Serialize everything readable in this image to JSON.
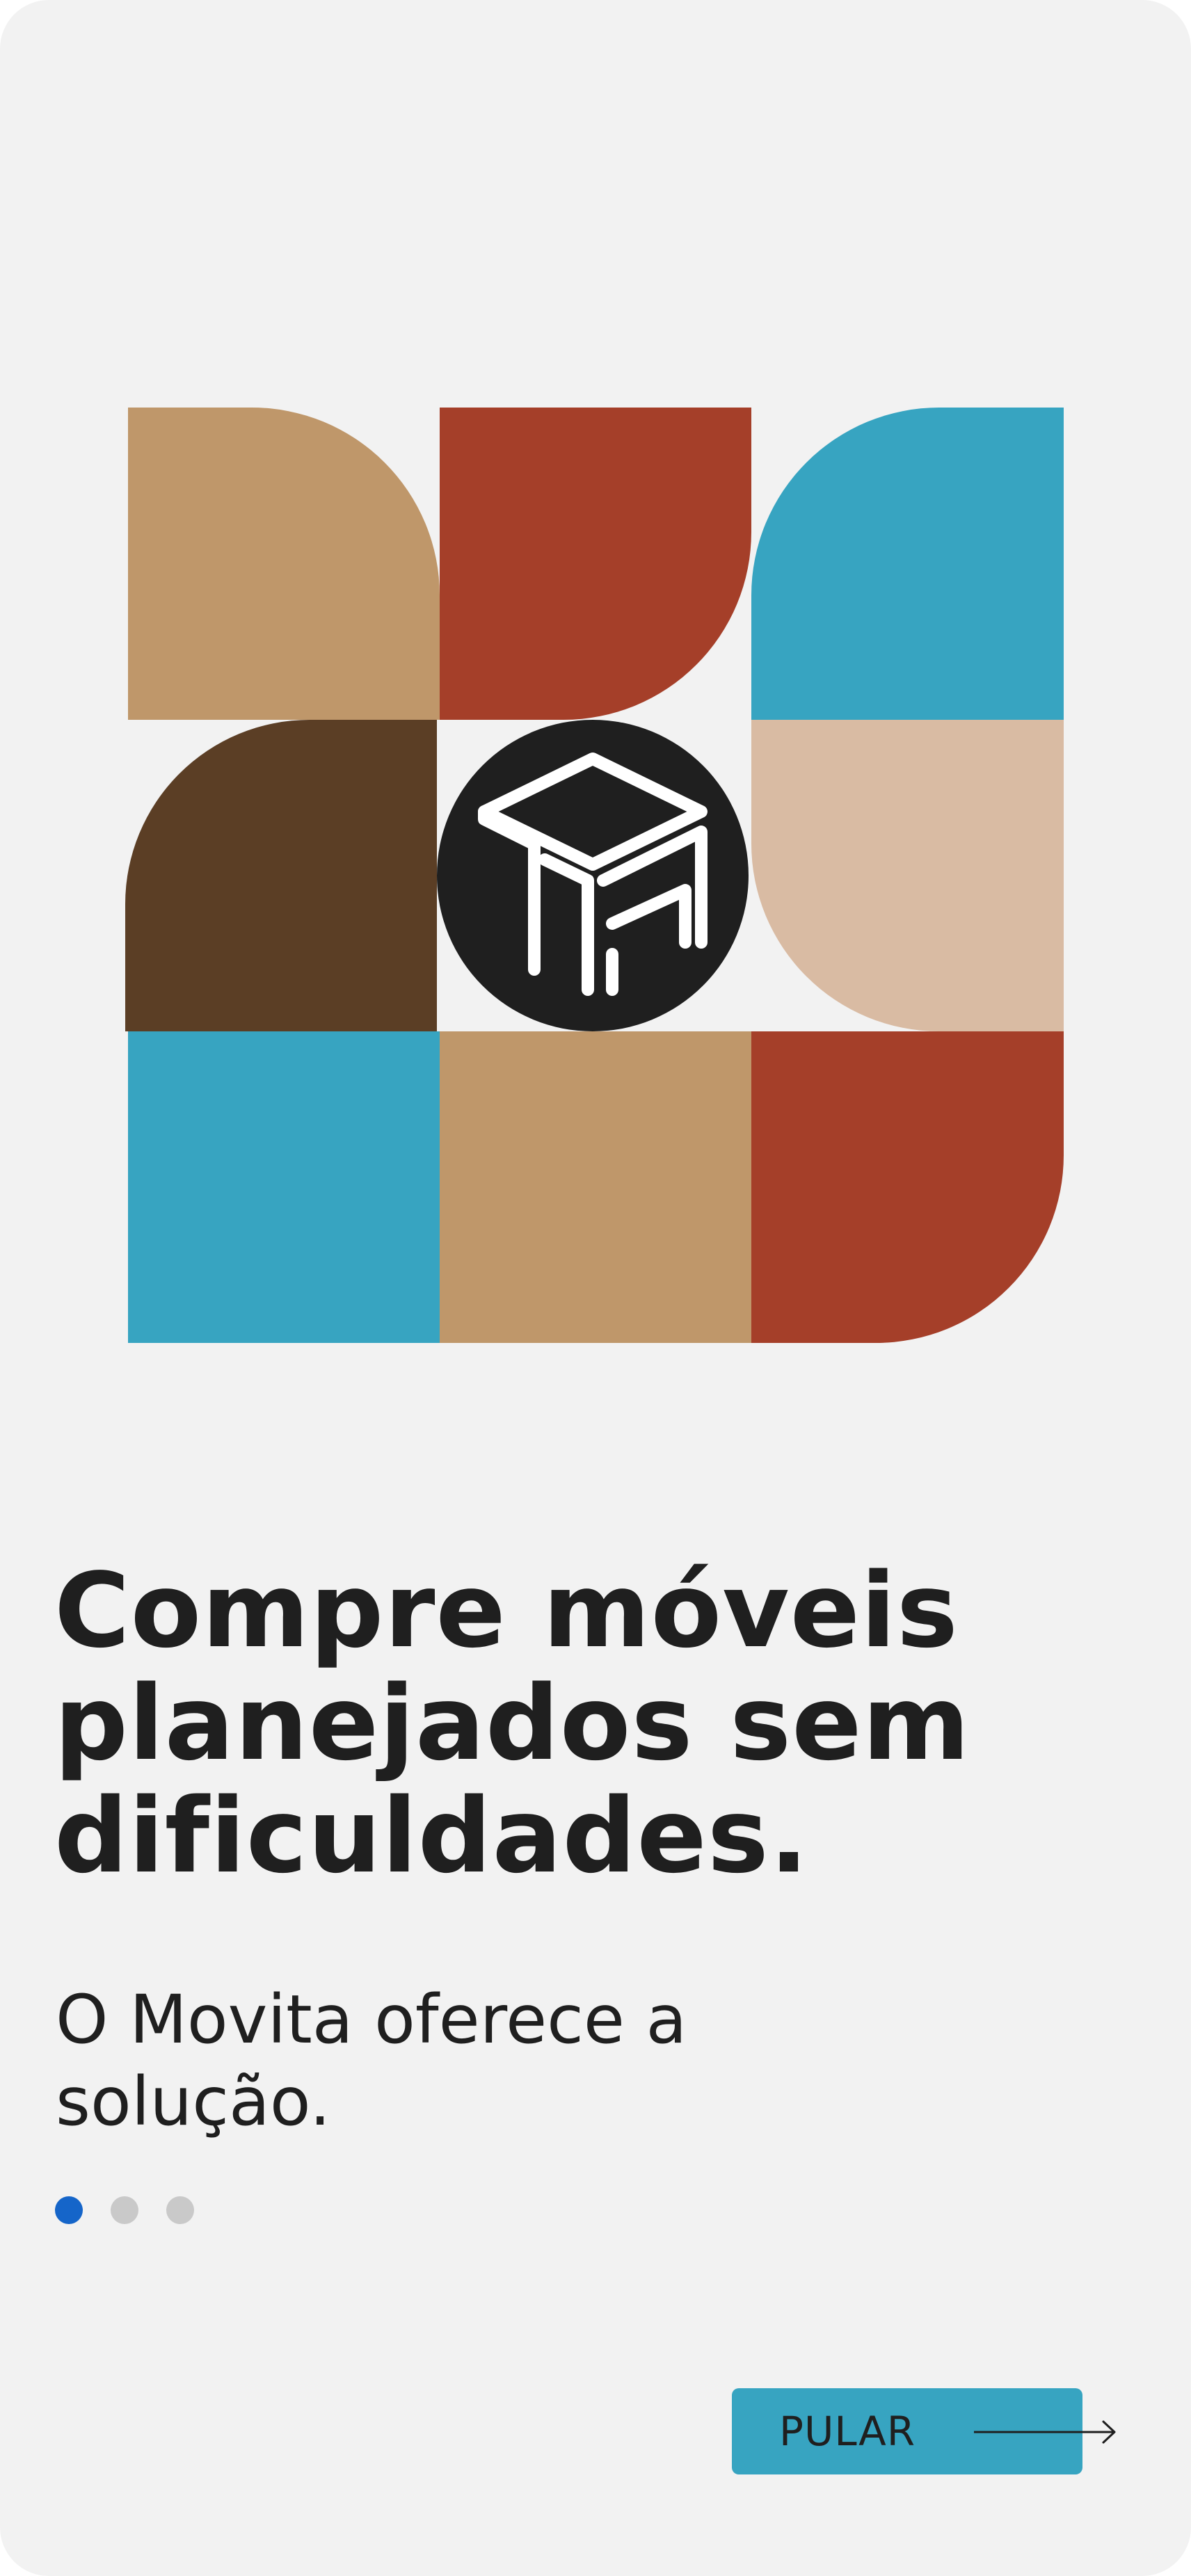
{
  "onboarding": {
    "title": "Compre móveis\nplanejados sem\ndificuldades.",
    "subtitle": "O Movita oferece a\nsolução.",
    "pagination": {
      "total": 3,
      "current": 1
    },
    "skip_label": "PULAR",
    "logo_icon": "desk-icon"
  },
  "colors": {
    "background": "#f2f2f2",
    "tan": "#bf976a",
    "rust": "#a53f29",
    "teal": "#37a4c1",
    "brown": "#5b3e25",
    "beige": "#d9bba3",
    "dark": "#1f1f1f",
    "dot_active": "#1565c9",
    "dot_inactive": "#c9c9c9",
    "button": "#37a4c1"
  }
}
